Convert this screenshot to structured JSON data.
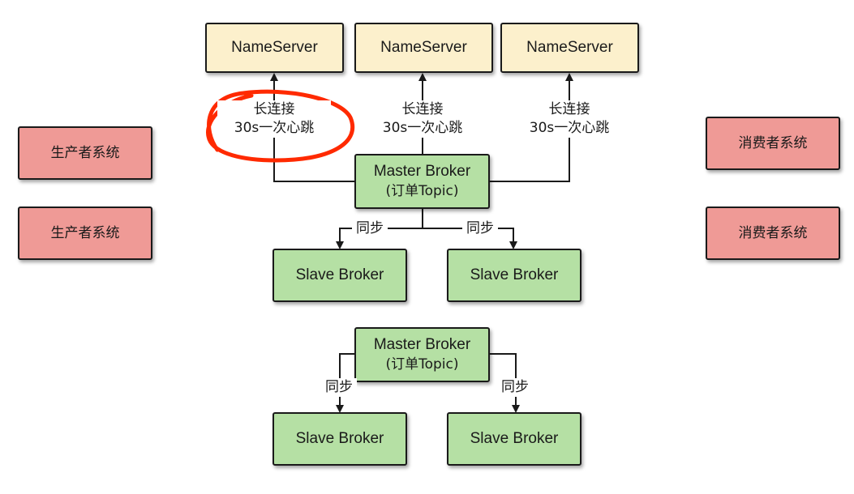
{
  "nameservers": [
    "NameServer",
    "NameServer",
    "NameServer"
  ],
  "connection": {
    "line1": "长连接",
    "line2": "30s一次心跳"
  },
  "producers": [
    "生产者系统",
    "生产者系统"
  ],
  "consumers": [
    "消费者系统",
    "消费者系统"
  ],
  "group1": {
    "master": {
      "line1": "Master Broker",
      "line2": "(订单Topic)"
    },
    "sync_label": "同步",
    "slaves": [
      "Slave Broker",
      "Slave Broker"
    ]
  },
  "group2": {
    "master": {
      "line1": "Master Broker",
      "line2": "(订单Topic)"
    },
    "sync_label": "同步",
    "slaves": [
      "Slave Broker",
      "Slave Broker"
    ]
  },
  "colors": {
    "nameserver": "#fcf0cc",
    "broker": "#b5e0a4",
    "system": "#ef9a96",
    "highlight": "#ff2a00"
  }
}
